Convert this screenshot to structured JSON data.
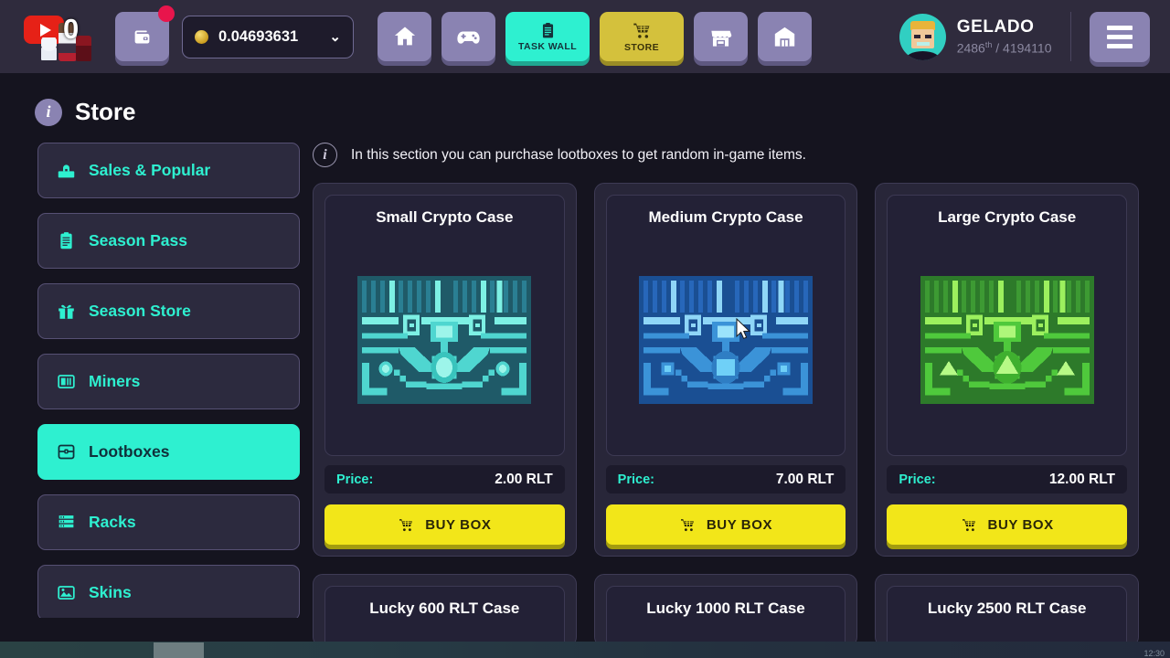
{
  "topbar": {
    "youtube_count": "0",
    "wallet_icon": "wallet-icon",
    "balance_value": "0.04693631",
    "nav": [
      {
        "id": "home",
        "label": "",
        "icon": "home-icon",
        "style": "sq"
      },
      {
        "id": "games",
        "label": "",
        "icon": "gamepad-icon",
        "style": "sq"
      },
      {
        "id": "task-wall",
        "label": "TASK WALL",
        "icon": "clipboard-icon",
        "style": "wide teal"
      },
      {
        "id": "store",
        "label": "STORE",
        "icon": "cart-icon",
        "style": "wide gold"
      },
      {
        "id": "market",
        "label": "",
        "icon": "shop-icon",
        "style": "sq"
      },
      {
        "id": "warehouse",
        "label": "",
        "icon": "warehouse-icon",
        "style": "sq"
      }
    ],
    "profile": {
      "name": "GELADO",
      "rank_number": "2486",
      "rank_suffix": "th",
      "rank_total": "/ 4194110"
    },
    "menu_icon": "hamburger-menu-icon"
  },
  "page": {
    "title": "Store",
    "notice": "In this section you can purchase lootboxes to get random in-game items."
  },
  "sidebar": {
    "items": [
      {
        "label": "Sales & Popular",
        "icon": "sale-tag-icon",
        "active": false
      },
      {
        "label": "Season Pass",
        "icon": "clipboard-icon",
        "active": false
      },
      {
        "label": "Season Store",
        "icon": "gift-icon",
        "active": false
      },
      {
        "label": "Miners",
        "icon": "miner-icon",
        "active": false
      },
      {
        "label": "Lootboxes",
        "icon": "lootbox-icon",
        "active": true
      },
      {
        "label": "Racks",
        "icon": "rack-icon",
        "active": false
      },
      {
        "label": "Skins",
        "icon": "image-icon",
        "active": false
      }
    ]
  },
  "store": {
    "price_label": "Price:",
    "buy_label": "BUY BOX",
    "cards": [
      {
        "title": "Small Crypto Case",
        "price": "2.00 RLT",
        "art": "chest-teal",
        "partial": false
      },
      {
        "title": "Medium Crypto Case",
        "price": "7.00 RLT",
        "art": "chest-blue",
        "partial": false
      },
      {
        "title": "Large Crypto Case",
        "price": "12.00 RLT",
        "art": "chest-green",
        "partial": false
      },
      {
        "title": "Lucky 600 RLT Case",
        "price": "",
        "art": "",
        "partial": true
      },
      {
        "title": "Lucky 1000 RLT Case",
        "price": "",
        "art": "",
        "partial": true
      },
      {
        "title": "Lucky 2500 RLT Case",
        "price": "",
        "art": "",
        "partial": true
      }
    ]
  },
  "desktop": {
    "clock": "12:30"
  },
  "colors": {
    "accent_teal": "#2ef0d0",
    "accent_yellow": "#f2e619",
    "accent_gold": "#d4c13c",
    "nav_purple": "#8a83b2",
    "bg_dark": "#15141f",
    "card_bg": "#282639"
  }
}
